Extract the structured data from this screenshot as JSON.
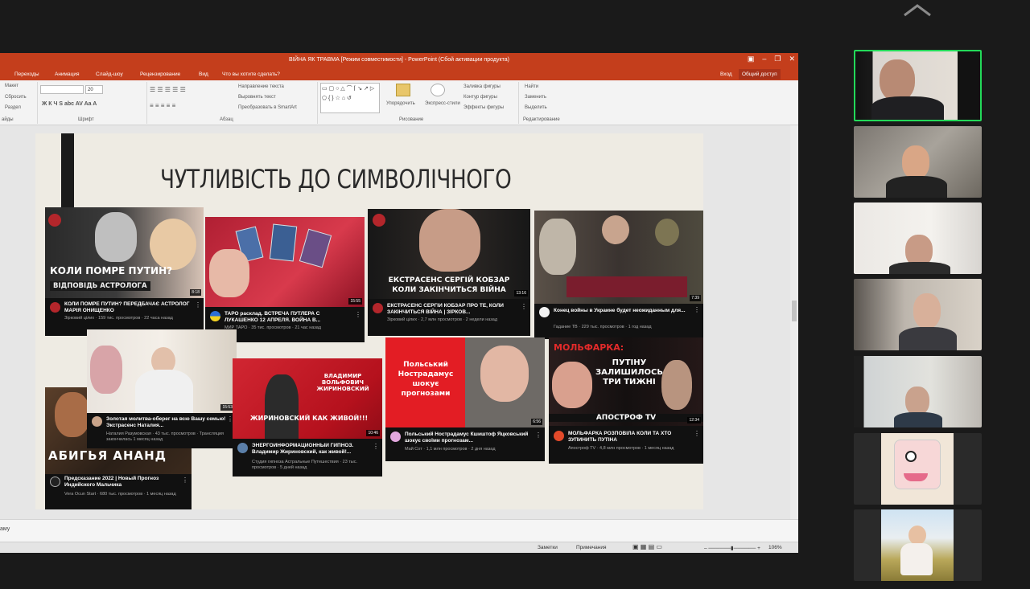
{
  "window": {
    "title": "ВІЙНА ЯК ТРАВМА [Режим совместимости] - PowerPoint (Сбой активации продукта)",
    "sign_in": "Вход",
    "share": "Общий доступ"
  },
  "ribbon_tabs": [
    "Переходы",
    "Анимация",
    "Слайд-шоу",
    "Рецензирование",
    "Вид",
    "Что вы хотите сделать?"
  ],
  "ribbon": {
    "slides_items": [
      "Макет",
      "Сбросить",
      "Раздел"
    ],
    "slides_group": "айды",
    "font_group": "Шрифт",
    "font_size": "20",
    "para_items": [
      "Направление текста",
      "Выровнять текст",
      "Преобразовать в SmartArt"
    ],
    "para_group": "Абзац",
    "draw_items": [
      "Упорядочить",
      "Экспресс-стили",
      "Заливка фигуры",
      "Контур фигуры",
      "Эффекты фигуры"
    ],
    "draw_group": "Рисование",
    "edit_items": [
      "Найти",
      "Заменить",
      "Выделить"
    ],
    "edit_group": "Редактирование"
  },
  "slide": {
    "title": "ЧУТЛИВІСТЬ ДО СИМВОЛІЧНОГО",
    "cards": [
      {
        "overlay": "КОЛИ ПОМРЕ ПУТИН?",
        "overlay2": "ВІДПОВІДЬ АСТРОЛОГА",
        "duration": "8:18",
        "title": "КОЛИ ПОМРЕ ПУТИН? ПЕРЕДБАЧАЄ АСТРОЛОГ МАРІЯ ОНИЩЕНКО",
        "meta": "Зірковий цілих · 159 тис. просмотров · 22 часа назад"
      },
      {
        "overlay": "",
        "overlay2": "",
        "duration": "15:55",
        "title": "ТАРО расклад. ВСТРЕЧА ПУТЛЕРА С ЛУКАШЕНКО 12 АПРЕЛЯ. ВОЙНА В...",
        "meta": "МИР ТАРО · 35 тис. просмотров · 21 час назад"
      },
      {
        "overlay": "ЕКСТРАСЕНС СЕРГІЙ КОБЗАР",
        "overlay2": "КОЛИ ЗАКІНЧИТЬСЯ ВІЙНА",
        "duration": "13:16",
        "title": "ЕКСТРАСЕНС СЕРГІЙ КОБЗАР ПРО ТЕ, КОЛИ ЗАКІНЧИТЬСЯ ВІЙНА | ЗІРКОВ...",
        "meta": "Зірковий цілих · 2,7 млн просмотров · 2 недели назад"
      },
      {
        "overlay": "",
        "overlay2": "",
        "duration": "7:39",
        "title": "Конец войны в Украине будет неожиданным для...",
        "meta": "Гадание ТВ · 229 тыс. просмотров · 1 год назад"
      },
      {
        "overlay": "",
        "overlay2": "",
        "duration": "15:53",
        "title": "Золотая молитва-оберег на всю Вашу семью!Экстрасенс Наталия...",
        "meta": "Наталия Разумовская · 43 тыс. просмотров · Трансляция закончилась 1 месяц назад"
      },
      {
        "overlay": "ВЛАДИМИР ВОЛЬФОВИЧ ЖИРИНОВСКИЙ",
        "overlay2": "ЖИРИНОВСКИЙ КАК ЖИВОЙ!!!",
        "duration": "10:46",
        "title": "ЭНЕРГОИНФОРМАЦИОННЫЙ ГИПНОЗ. Владимир Жириновский, как живой!...",
        "meta": "Студия гипноза Астральные Путешествия · 23 тыс. просмотров · 5 дней назад"
      },
      {
        "overlay": "Польський Нострадамус шокує прогнозами",
        "overlay2": "",
        "duration": "6:56",
        "title": "Польський Нострадамус Кшиштоф Яцковський шокує своїми прогнозам...",
        "meta": "Май Сот · 1,1 млн просмотров · 2 дня назад"
      },
      {
        "overlay": "МОЛЬФАРКА:",
        "overlay2": "ПУТІНУ ЗАЛИШИЛОСЬ ТРИ ТИЖНІ",
        "duration": "12:34",
        "title": "МОЛЬФАРКА РОЗПОВІЛА КОЛИ ТА ХТО ЗУПИНИТЬ ПУТІНА",
        "meta": "Апостроф TV · 4,8 млн просмотров · 1 месяц назад"
      },
      {
        "overlay": "АБИГЬЯ АНАНД",
        "overlay2": "",
        "duration": "",
        "title": "Предсказание 2022 | Новый Прогноз Индийского Мальчика",
        "meta": "Vera Ocun Start · 680 тыс. просмотров · 1 месяц назад"
      }
    ],
    "brand_apostrof": "АПОСТРОФ TV"
  },
  "notes_text": "аму",
  "status": {
    "notes": "Заметки",
    "comments": "Примечания",
    "zoom": "106%"
  }
}
